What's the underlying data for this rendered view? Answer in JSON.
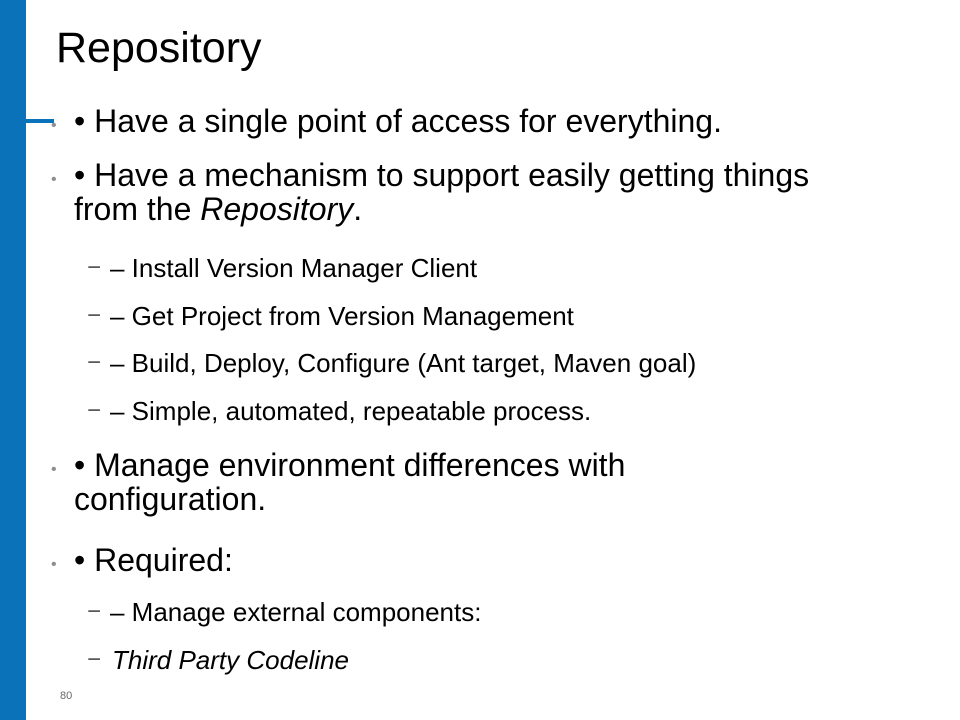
{
  "slide": {
    "title": "Repository",
    "page_number": "80",
    "bullet_glyph": "•",
    "dash_glyph": "−",
    "accent_color": "#0a72b9",
    "items": [
      {
        "level": 1,
        "text": "• Have a single point of access for everything."
      },
      {
        "level": 1,
        "text_main": "• Have a mechanism to support easily getting things from the ",
        "text_em": "Repository",
        "text_end": "."
      },
      {
        "level": 2,
        "text": "– Install Version Manager Client"
      },
      {
        "level": 2,
        "text": "– Get Project from Version Management"
      },
      {
        "level": 2,
        "text": "– Build, Deploy, Configure (Ant target, Maven goal)"
      },
      {
        "level": 2,
        "text": "– Simple, automated, repeatable process."
      },
      {
        "level": 1,
        "text": "• Manage environment differences with configuration."
      },
      {
        "level": 1,
        "text": "• Required:"
      },
      {
        "level": 2,
        "text": "– Manage external components:"
      },
      {
        "level": 2,
        "text": "Third Party Codeline",
        "italic": true
      }
    ]
  }
}
